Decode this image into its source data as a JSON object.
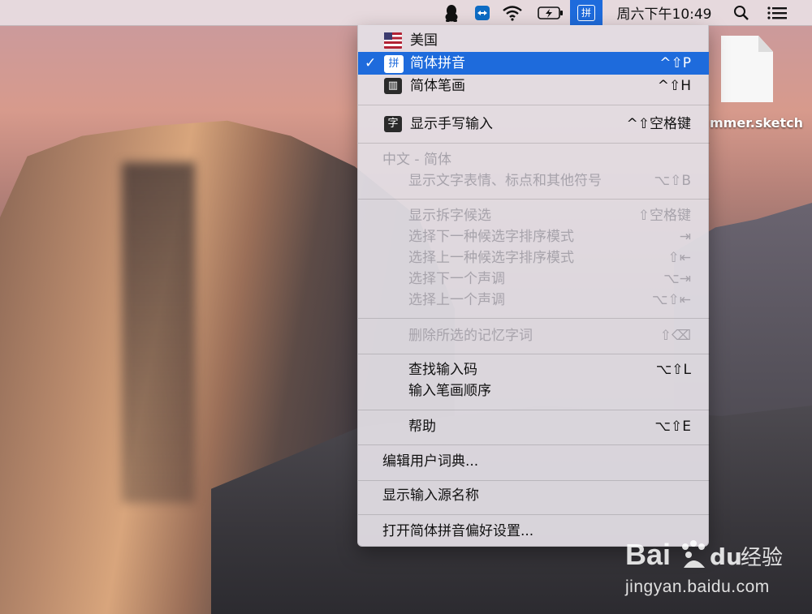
{
  "menubar": {
    "ime_label": "拼",
    "clock": "周六下午10:49",
    "icons": [
      "qq-penguin-icon",
      "teamviewer-icon",
      "wifi-icon",
      "battery-charging-icon",
      "ime-pinyin-icon",
      "spotlight-search-icon",
      "notification-list-icon"
    ]
  },
  "desktop": {
    "file_label": "mmer.sketch"
  },
  "menu": {
    "input_sources": [
      {
        "label": "美国",
        "shortcut": "",
        "icon": "us-flag-icon"
      },
      {
        "label": "简体拼音",
        "shortcut": "^⇧P",
        "icon": "pinyin-icon",
        "icon_char": "拼",
        "checked": "✓"
      },
      {
        "label": "简体笔画",
        "shortcut": "^⇧H",
        "icon": "stroke-icon",
        "icon_char": "▥"
      }
    ],
    "handwriting": {
      "label": "显示手写输入",
      "shortcut": "^⇧空格键",
      "icon_char": "字"
    },
    "section_header": "中文 - 简体",
    "emoji": {
      "label": "显示文字表情、标点和其他符号",
      "shortcut": "⌥⇧B"
    },
    "candidates": [
      {
        "label": "显示拆字候选",
        "shortcut": "⇧空格键"
      },
      {
        "label": "选择下一种候选字排序模式",
        "shortcut": "⇥"
      },
      {
        "label": "选择上一种候选字排序模式",
        "shortcut": "⇧⇤"
      },
      {
        "label": "选择下一个声调",
        "shortcut": "⌥⇥"
      },
      {
        "label": "选择上一个声调",
        "shortcut": "⌥⇧⇤"
      }
    ],
    "delete_memory": {
      "label": "删除所选的记忆字词",
      "shortcut": "⇧⌫"
    },
    "lookup": [
      {
        "label": "查找输入码",
        "shortcut": "⌥⇧L"
      },
      {
        "label": "输入笔画顺序",
        "shortcut": ""
      }
    ],
    "help": {
      "label": "帮助",
      "shortcut": "⌥⇧E"
    },
    "edit_dict": "编辑用户词典...",
    "show_source_name": "显示输入源名称",
    "open_prefs": "打开简体拼音偏好设置..."
  },
  "watermark": {
    "brand": "Bai",
    "brand_cn": "经验",
    "url": "jingyan.baidu.com"
  }
}
